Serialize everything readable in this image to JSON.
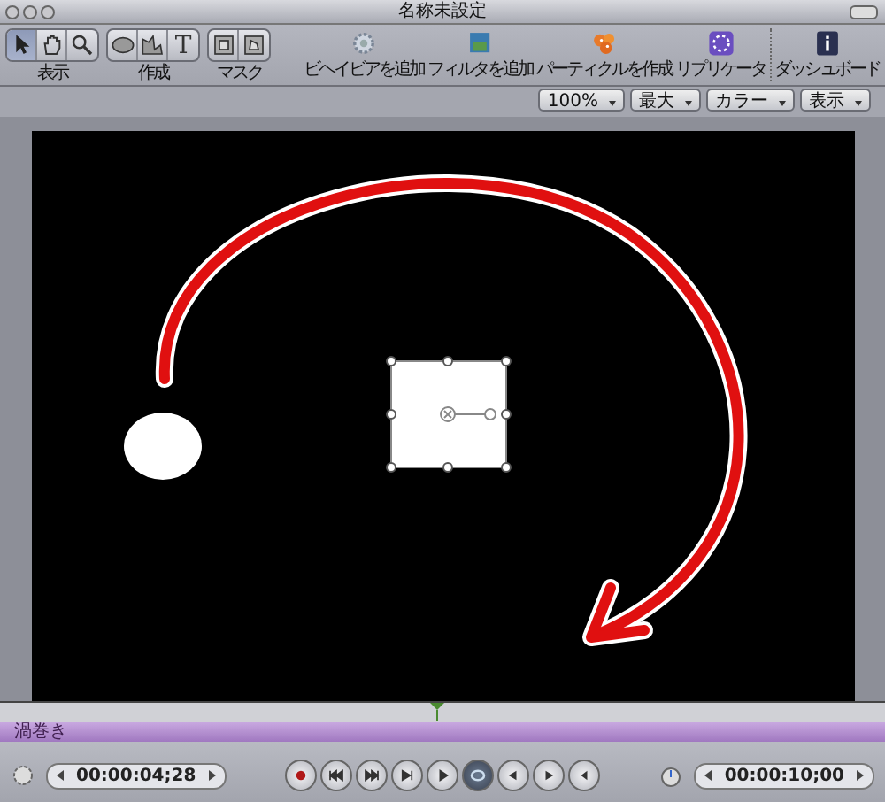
{
  "window": {
    "title": "名称未設定"
  },
  "tool_groups": [
    {
      "label": "表示",
      "tools": [
        {
          "kind": "arrow",
          "selected": true
        },
        {
          "kind": "hand",
          "selected": false
        },
        {
          "kind": "zoom",
          "selected": false
        }
      ]
    },
    {
      "label": "作成",
      "tools": [
        {
          "kind": "ellipse",
          "selected": false
        },
        {
          "kind": "pen",
          "selected": false
        },
        {
          "kind": "text",
          "selected": false,
          "glyph": "T"
        }
      ]
    },
    {
      "label": "マスク",
      "tools": [
        {
          "kind": "rectmask",
          "selected": false
        },
        {
          "kind": "penmask",
          "selected": false
        }
      ]
    }
  ],
  "actions": [
    {
      "kind": "behavior",
      "label": "ビヘイビアを追加"
    },
    {
      "kind": "filter",
      "label": "フィルタを追加"
    },
    {
      "kind": "particles",
      "label": "パーティクルを作成"
    },
    {
      "kind": "replicator",
      "label": "リプリケータ"
    },
    {
      "kind": "dashboard",
      "label": "ダッシュボード"
    }
  ],
  "view_options": [
    {
      "value": "100%"
    },
    {
      "value": "最大"
    },
    {
      "value": "カラー"
    },
    {
      "value": "表示"
    }
  ],
  "timeline": {
    "layer": "渦巻き"
  },
  "transport": {
    "current_time": "00:00:04;28",
    "duration": "00:00:10;00",
    "buttons": [
      {
        "kind": "record",
        "on": false
      },
      {
        "kind": "start",
        "on": false
      },
      {
        "kind": "end",
        "on": false
      },
      {
        "kind": "step",
        "on": false
      },
      {
        "kind": "play",
        "on": false
      },
      {
        "kind": "loop",
        "on": true
      },
      {
        "kind": "prev-key",
        "on": false
      },
      {
        "kind": "next-key",
        "on": false
      },
      {
        "kind": "audio",
        "on": false
      }
    ]
  }
}
